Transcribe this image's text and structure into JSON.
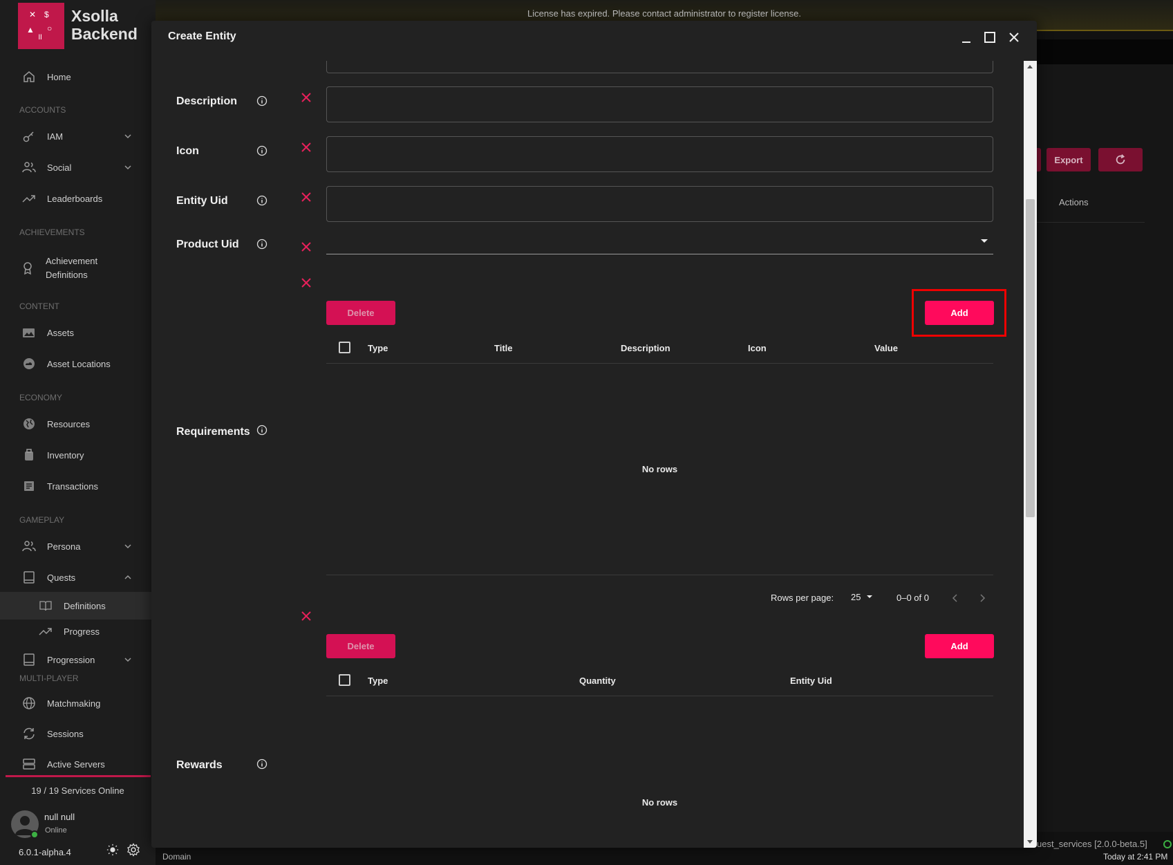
{
  "banner": {
    "text": "License has expired. Please contact administrator to register license."
  },
  "brand": {
    "line1": "Xsolla",
    "line2": "Backend"
  },
  "sidebar": {
    "home": "Home",
    "sections": {
      "accounts": "ACCOUNTS",
      "achievements": "ACHIEVEMENTS",
      "content": "CONTENT",
      "economy": "ECONOMY",
      "gameplay": "GAMEPLAY",
      "multiplayer": "MULTI-PLAYER"
    },
    "iam": "IAM",
    "social": "Social",
    "leaderboards": "Leaderboards",
    "achievement_definitions_1": "Achievement",
    "achievement_definitions_2": "Definitions",
    "assets": "Assets",
    "asset_locations": "Asset Locations",
    "resources": "Resources",
    "inventory": "Inventory",
    "transactions": "Transactions",
    "persona": "Persona",
    "quests": "Quests",
    "definitions": "Definitions",
    "progress": "Progress",
    "progression": "Progression",
    "matchmaking": "Matchmaking",
    "sessions": "Sessions",
    "active_servers": "Active Servers",
    "services_online": "19 / 19 Services Online",
    "user_name": "null null",
    "user_status": "Online",
    "version": "6.0.1-alpha.4"
  },
  "background": {
    "export": "Export",
    "actions": "Actions",
    "services_version": "uest_services  [2.0.0-beta.5]",
    "time": "Today at 2:41 PM",
    "domain": "Domain"
  },
  "dialog": {
    "title": "Create Entity",
    "fields": {
      "description": "Description",
      "icon": "Icon",
      "entity_uid": "Entity Uid",
      "product_uid": "Product Uid",
      "requirements": "Requirements",
      "rewards": "Rewards"
    },
    "requirements_grid": {
      "delete": "Delete",
      "add": "Add",
      "columns": [
        "Type",
        "Title",
        "Description",
        "Icon",
        "Value"
      ],
      "empty": "No rows",
      "rows_per_page_label": "Rows per page:",
      "rows_per_page": "25",
      "range": "0–0 of 0"
    },
    "rewards_grid": {
      "delete": "Delete",
      "add": "Add",
      "columns": [
        "Type",
        "Quantity",
        "Entity Uid"
      ],
      "empty": "No rows"
    }
  }
}
